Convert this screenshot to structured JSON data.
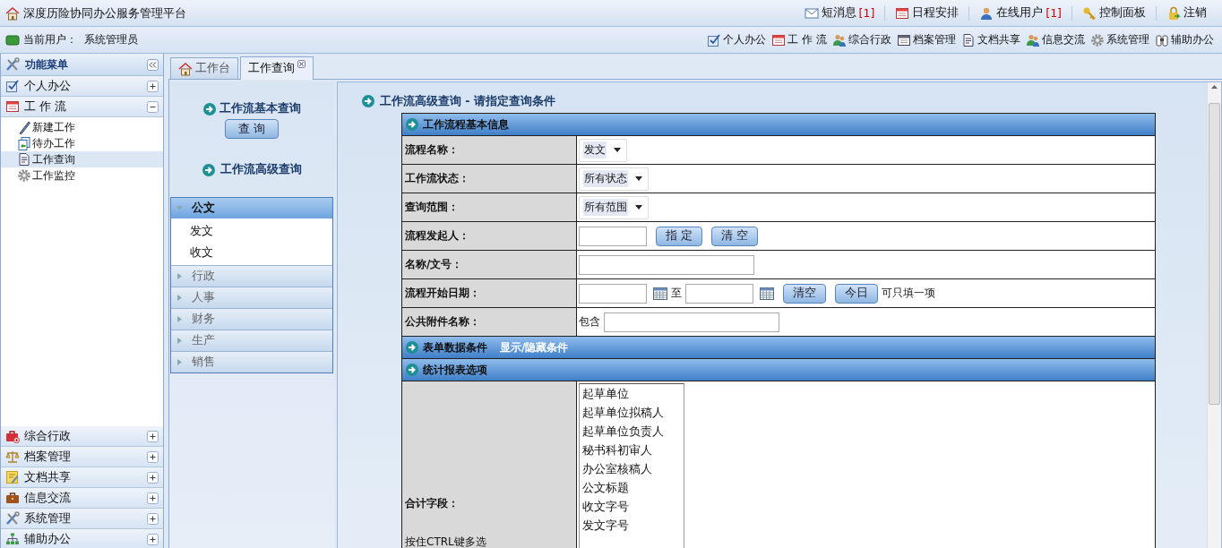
{
  "app": {
    "title": "深度历险协同办公服务管理平台"
  },
  "top_links": [
    {
      "label": "短消息",
      "count": "[1]",
      "kind": "mail"
    },
    {
      "label": "日程安排",
      "kind": "calendar"
    },
    {
      "label": "在线用户",
      "count": "[1]",
      "kind": "user"
    },
    {
      "label": "控制面板",
      "kind": "key"
    },
    {
      "label": "注销",
      "kind": "lock"
    }
  ],
  "current_user": {
    "label": "当前用户：",
    "name": "系统管理员"
  },
  "modules": [
    {
      "label": "个人办公",
      "kind": "checkbox"
    },
    {
      "label": "工 作 流",
      "kind": "calendar"
    },
    {
      "label": "综合行政",
      "kind": "people"
    },
    {
      "label": "档案管理",
      "kind": "window"
    },
    {
      "label": "文档共享",
      "kind": "document"
    },
    {
      "label": "信息交流",
      "kind": "people"
    },
    {
      "label": "系统管理",
      "kind": "gear"
    },
    {
      "label": "辅助办公",
      "kind": "binoculars"
    }
  ],
  "sidebar": {
    "title": "功能菜单",
    "groups": [
      {
        "label": "个人办公",
        "kind": "checkbox",
        "expanded": false
      },
      {
        "label": "工 作 流",
        "kind": "calendar",
        "expanded": true,
        "children": [
          {
            "label": "新建工作",
            "kind": "pen",
            "selected": false
          },
          {
            "label": "待办工作",
            "kind": "pages",
            "selected": false
          },
          {
            "label": "工作查询",
            "kind": "document",
            "selected": true
          },
          {
            "label": "工作监控",
            "kind": "gear",
            "selected": false
          }
        ]
      },
      {
        "label": "综合行政",
        "kind": "briefcase",
        "expanded": false
      },
      {
        "label": "档案管理",
        "kind": "scales",
        "expanded": false
      },
      {
        "label": "文档共享",
        "kind": "note",
        "expanded": false
      },
      {
        "label": "信息交流",
        "kind": "case",
        "expanded": false
      },
      {
        "label": "系统管理",
        "kind": "tools",
        "expanded": false
      },
      {
        "label": "辅助办公",
        "kind": "tree",
        "expanded": false
      }
    ]
  },
  "tabs": [
    {
      "label": "工作台",
      "selected": false,
      "closable": false
    },
    {
      "label": "工作查询",
      "selected": true,
      "closable": true
    }
  ],
  "query_panel": {
    "basic_title": "工作流基本查询",
    "query_button": "查 询",
    "advanced_title": "工作流高级查询",
    "categories": [
      {
        "label": "公文",
        "expanded": true,
        "children": [
          "发文",
          "收文"
        ]
      },
      {
        "label": "行政",
        "expanded": false
      },
      {
        "label": "人事",
        "expanded": false
      },
      {
        "label": "财务",
        "expanded": false
      },
      {
        "label": "生产",
        "expanded": false
      },
      {
        "label": "销售",
        "expanded": false
      }
    ]
  },
  "form": {
    "title": "工作流高级查询 - 请指定查询条件",
    "sections": [
      {
        "title": "工作流程基本信息",
        "rows": [
          {
            "label": "流程名称：",
            "controls": [
              {
                "kind": "select",
                "value": "发文"
              }
            ]
          },
          {
            "label": "工作流状态：",
            "controls": [
              {
                "kind": "select",
                "value": "所有状态"
              }
            ]
          },
          {
            "label": "查询范围：",
            "controls": [
              {
                "kind": "select",
                "value": "所有范围"
              }
            ]
          },
          {
            "label": "流程发起人：",
            "controls": [
              {
                "kind": "input",
                "wide": false
              },
              {
                "kind": "button",
                "label": "指 定"
              },
              {
                "kind": "button",
                "label": "清 空"
              }
            ]
          },
          {
            "label": "名称/文号：",
            "controls": [
              {
                "kind": "input",
                "wide": true
              }
            ]
          },
          {
            "label": "流程开始日期：",
            "controls": [
              {
                "kind": "input",
                "wide": false
              },
              {
                "kind": "date"
              },
              {
                "kind": "text",
                "label": "至"
              },
              {
                "kind": "input",
                "wide": false
              },
              {
                "kind": "date"
              },
              {
                "kind": "button",
                "label": "清空"
              },
              {
                "kind": "button",
                "label": "今日"
              },
              {
                "kind": "text",
                "label": "可只填一项"
              }
            ]
          },
          {
            "label": "公共附件名称：",
            "controls": [
              {
                "kind": "text",
                "label": "包含"
              },
              {
                "kind": "input",
                "wide": true
              }
            ]
          }
        ]
      },
      {
        "title": "表单数据条件",
        "link": "显示/隐藏条件"
      },
      {
        "title": "统计报表选项",
        "rows": [
          {
            "label": "合计字段：",
            "note": "按住CTRL键多选",
            "controls": [
              {
                "kind": "listbox",
                "options": [
                  "起草单位",
                  "起草单位拟稿人",
                  "起草单位负责人",
                  "秘书科初审人",
                  "办公室核稿人",
                  "公文标题",
                  "收文字号",
                  "发文字号"
                ]
              }
            ]
          }
        ]
      }
    ]
  }
}
